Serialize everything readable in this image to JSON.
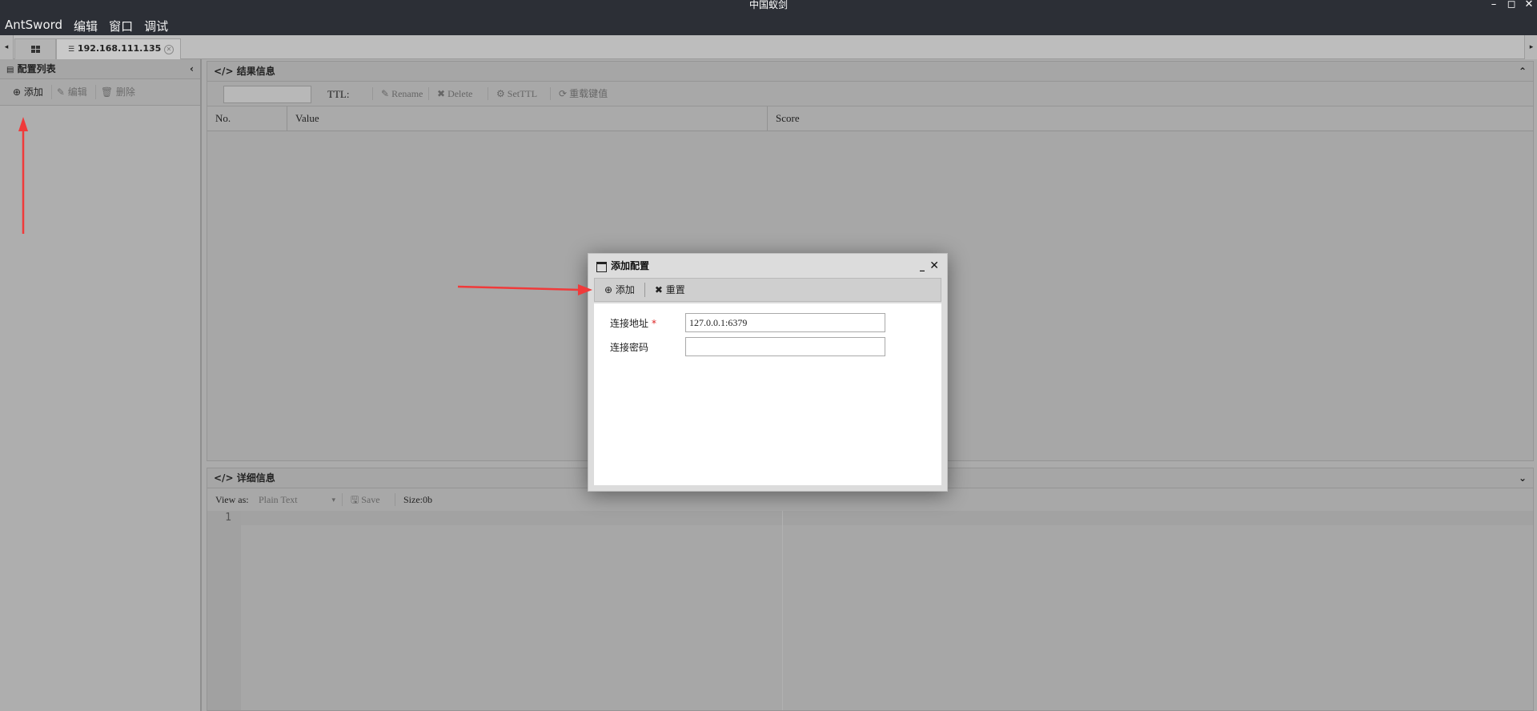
{
  "window": {
    "title": "中国蚁剑",
    "controls": {
      "minimize": "–",
      "maximize": "◻",
      "close": "✕"
    }
  },
  "menu": [
    "AntSword",
    "编辑",
    "窗口",
    "调试"
  ],
  "tabs": {
    "left_arrow": "◂",
    "right_arrow": "▸",
    "home_icon": "grid-icon",
    "host_tab": "192.168.111.135"
  },
  "config_panel": {
    "title": "配置列表",
    "toolbar": {
      "add": "添加",
      "edit": "编辑",
      "delete": "删除"
    }
  },
  "result_panel": {
    "title": "结果信息",
    "ttl_label": "TTL:",
    "toolbar": {
      "rename": "Rename",
      "delete": "Delete",
      "setttl": "SetTTL",
      "reload": "重载键值"
    },
    "columns": [
      "No.",
      "Value",
      "Score"
    ]
  },
  "detail_panel": {
    "title": "详细信息",
    "view_as_label": "View as:",
    "view_as_value": "Plain Text",
    "save_label": "Save",
    "size_label": "Size:0b",
    "line_number": "1"
  },
  "modal": {
    "title": "添加配置",
    "toolbar": {
      "add": "添加",
      "reset": "重置"
    },
    "fields": [
      {
        "label": "连接地址",
        "required_mark": "*",
        "value": "127.0.0.1:6379"
      },
      {
        "label": "连接密码",
        "value": ""
      }
    ]
  },
  "annotation_color": "#f03a3a"
}
